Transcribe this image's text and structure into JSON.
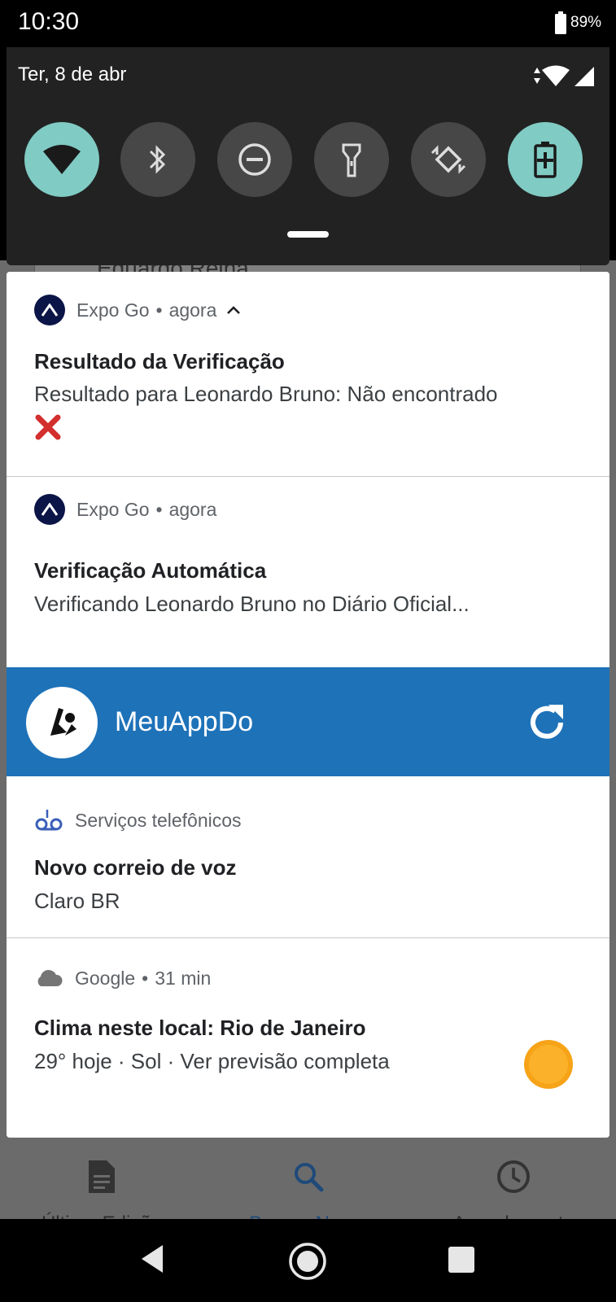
{
  "status_bar": {
    "time": "10:30",
    "battery": "89%"
  },
  "quick_settings": {
    "date": "Ter, 8 de abr",
    "tiles": [
      {
        "name": "wifi",
        "state": "on"
      },
      {
        "name": "bluetooth",
        "state": "off"
      },
      {
        "name": "do-not-disturb",
        "state": "off"
      },
      {
        "name": "flashlight",
        "state": "off"
      },
      {
        "name": "auto-rotate",
        "state": "off"
      },
      {
        "name": "battery-saver",
        "state": "on"
      }
    ],
    "colors": {
      "panel": "#222222",
      "tile_on": "#80cbc4",
      "tile_off": "#474747"
    }
  },
  "background_app": {
    "partial_name": "Eduardo Reina",
    "tabs": [
      {
        "label": "Última Edição",
        "icon": "document-icon"
      },
      {
        "label": "Buscar Nome",
        "icon": "search-icon"
      },
      {
        "label": "Agendamento",
        "icon": "clock-icon"
      }
    ]
  },
  "notifications": [
    {
      "app": "Expo Go",
      "time": "agora",
      "expanded": true,
      "title": "Resultado da Verificação",
      "body": "Resultado para Leonardo Bruno: Não encontrado",
      "emoji": "❌"
    },
    {
      "app": "Expo Go",
      "time": "agora",
      "title": "Verificação Automática",
      "body": "Verificando Leonardo Bruno no Diário Oficial..."
    },
    {
      "app": "MeuAppDo",
      "type": "media-widget",
      "color": "#1e72b8"
    },
    {
      "app": "Serviços telefônicos",
      "title": "Novo correio de voz",
      "body": "Claro BR"
    },
    {
      "app": "Google",
      "time": "31 min",
      "title": "Clima neste local: Rio de Janeiro",
      "body": "29° hoje · Sol · Ver previsão completa"
    }
  ],
  "separator": "•"
}
